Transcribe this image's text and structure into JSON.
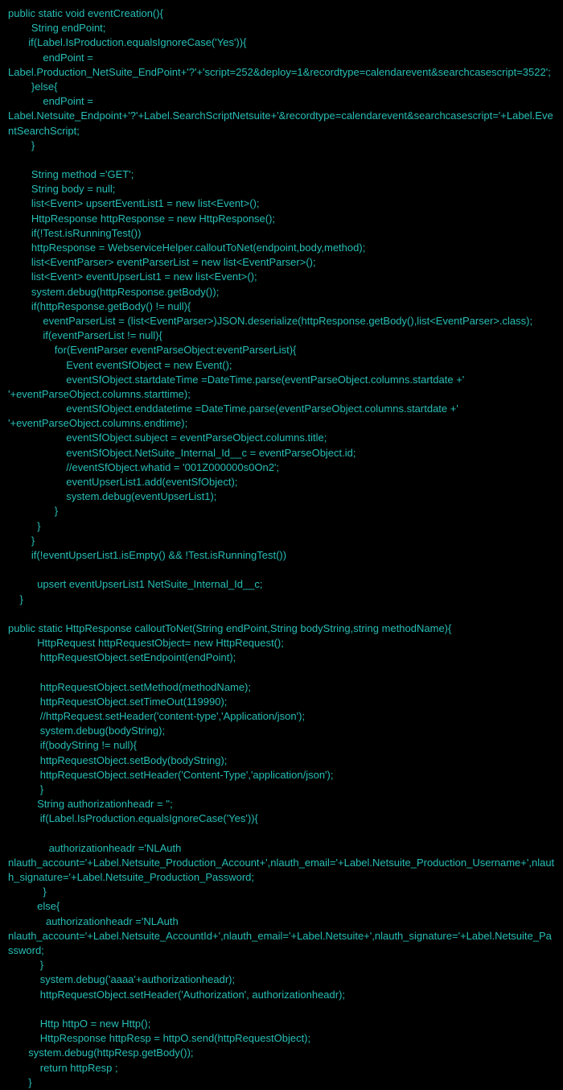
{
  "code": {
    "lines": [
      "public static void eventCreation(){",
      "        String endPoint;",
      "       if(Label.IsProduction.equalsIgnoreCase('Yes')){",
      "            endPoint = Label.Production_NetSuite_EndPoint+'?'+'script=252&deploy=1&recordtype=calendarevent&searchcasescript=3522';",
      "        }else{",
      "            endPoint = Label.Netsuite_Endpoint+'?'+Label.SearchScriptNetsuite+'&recordtype=calendarevent&searchcasescript='+Label.EventSearchScript;",
      "        }",
      "",
      "        String method ='GET';",
      "        String body = null;",
      "        list<Event> upsertEventList1 = new list<Event>();",
      "        HttpResponse httpResponse = new HttpResponse();",
      "        if(!Test.isRunningTest())",
      "        httpResponse = WebserviceHelper.calloutToNet(endpoint,body,method);",
      "        list<EventParser> eventParserList = new list<EventParser>();",
      "        list<Event> eventUpserList1 = new list<Event>();",
      "        system.debug(httpResponse.getBody());",
      "        if(httpResponse.getBody() != null){",
      "            eventParserList = (list<EventParser>)JSON.deserialize(httpResponse.getBody(),list<EventParser>.class);",
      "            if(eventParserList != null){",
      "                for(EventParser eventParseObject:eventParserList){",
      "                    Event eventSfObject = new Event();",
      "                    eventSfObject.startdateTime =DateTime.parse(eventParseObject.columns.startdate +' '+eventParseObject.columns.starttime);",
      "                    eventSfObject.enddatetime =DateTime.parse(eventParseObject.columns.startdate +' '+eventParseObject.columns.endtime);",
      "                    eventSfObject.subject = eventParseObject.columns.title;",
      "                    eventSfObject.NetSuite_Internal_Id__c = eventParseObject.id;",
      "                    //eventSfObject.whatid = '001Z000000s0On2';",
      "                    eventUpserList1.add(eventSfObject);",
      "                    system.debug(eventUpserList1);",
      "                }",
      "          }",
      "        }",
      "        if(!eventUpserList1.isEmpty() && !Test.isRunningTest())",
      "",
      "          upsert eventUpserList1 NetSuite_Internal_Id__c;",
      "    }",
      "",
      "public static HttpResponse calloutToNet(String endPoint,String bodyString,string methodName){",
      "          HttpRequest httpRequestObject= new HttpRequest();",
      "           httpRequestObject.setEndpoint(endPoint);",
      "",
      "           httpRequestObject.setMethod(methodName);",
      "           httpRequestObject.setTimeOut(119990);",
      "           //httpRequest.setHeader('content-type','Application/json');",
      "           system.debug(bodyString);",
      "           if(bodyString != null){",
      "           httpRequestObject.setBody(bodyString);",
      "           httpRequestObject.setHeader('Content-Type','application/json');",
      "           }",
      "          String authorizationheadr = '';",
      "           if(Label.IsProduction.equalsIgnoreCase('Yes')){",
      "",
      "              authorizationheadr ='NLAuth nlauth_account='+Label.Netsuite_Production_Account+',nlauth_email='+Label.Netsuite_Production_Username+',nlauth_signature='+Label.Netsuite_Production_Password;",
      "            }",
      "          else{",
      "             authorizationheadr ='NLAuth nlauth_account='+Label.Netsuite_AccountId+',nlauth_email='+Label.Netsuite+',nlauth_signature='+Label.Netsuite_Password;",
      "           }",
      "           system.debug('aaaa'+authorizationheadr);",
      "           httpRequestObject.setHeader('Authorization', authorizationheadr);",
      "",
      "           Http httpO = new Http();",
      "           HttpResponse httpResp = httpO.send(httpRequestObject);",
      "       system.debug(httpResp.getBody());",
      "           return httpResp ;",
      "       }"
    ]
  }
}
